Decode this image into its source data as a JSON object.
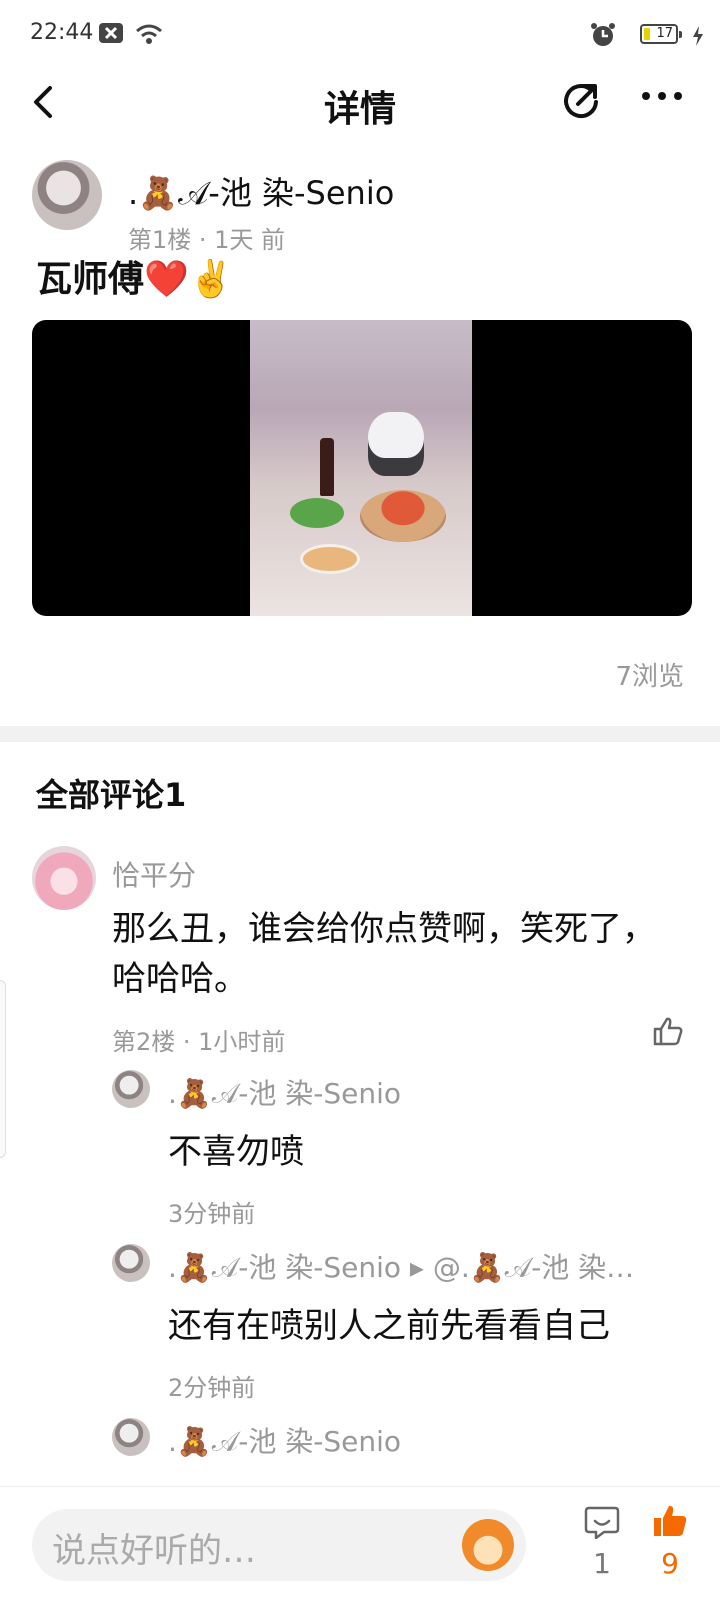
{
  "status_bar": {
    "time": "22:44",
    "battery_level": "17"
  },
  "header": {
    "title": "详情"
  },
  "post": {
    "author_name": ".🧸𝒜-池 染-Senio",
    "floor_meta": "第1楼 · 1天 前",
    "text": "瓦师傅❤️✌️",
    "views": "7浏览"
  },
  "comments_section": {
    "title": "全部评论1"
  },
  "comment": {
    "name": "恰平分",
    "text": "那么丑，谁会给你点赞啊，笑死了，哈哈哈。",
    "meta": "第2楼 · 1小时前",
    "replies": [
      {
        "name": ".🧸𝒜-池 染-Senio",
        "text": "不喜勿喷",
        "time": "3分钟前"
      },
      {
        "name": ".🧸𝒜-池 染-Senio ▸ @.🧸𝒜-池 染…",
        "text": "还有在喷别人之前先看看自己",
        "time": "2分钟前"
      },
      {
        "name": ".🧸𝒜-池 染-Senio",
        "text": "",
        "time": ""
      }
    ]
  },
  "bottom_bar": {
    "placeholder": "说点好听的…",
    "comment_count": "1",
    "like_count": "9"
  },
  "colors": {
    "accent": "#f56a00",
    "muted_text": "#999999"
  }
}
